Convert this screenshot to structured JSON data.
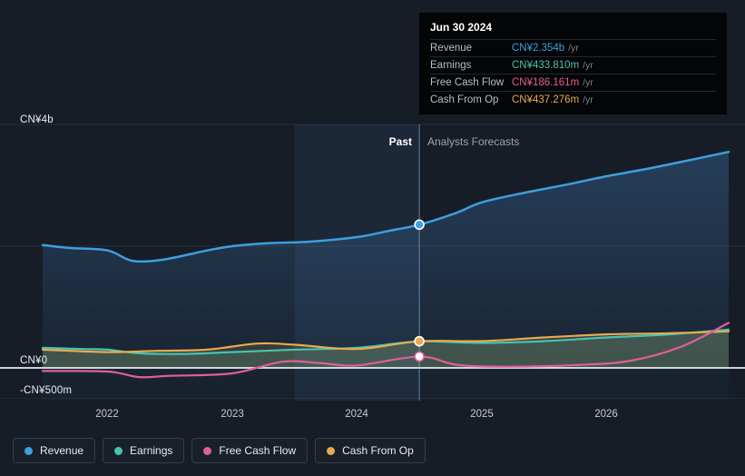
{
  "labels": {
    "past": "Past",
    "analysts_forecasts": "Analysts Forecasts"
  },
  "tooltip": {
    "date": "Jun 30 2024",
    "rows": [
      {
        "label": "Revenue",
        "value": "CN¥2.354b",
        "suffix": "/yr",
        "color": "#3d9fe0"
      },
      {
        "label": "Earnings",
        "value": "CN¥433.810m",
        "suffix": "/yr",
        "color": "#45c4b0"
      },
      {
        "label": "Free Cash Flow",
        "value": "CN¥186.161m",
        "suffix": "/yr",
        "color": "#e05f9a"
      },
      {
        "label": "Cash From Op",
        "value": "CN¥437.276m",
        "suffix": "/yr",
        "color": "#e8aa50"
      }
    ]
  },
  "legend": {
    "items": [
      {
        "label": "Revenue",
        "color": "#3d9fe0"
      },
      {
        "label": "Earnings",
        "color": "#45c4b0"
      },
      {
        "label": "Free Cash Flow",
        "color": "#e05f9a"
      },
      {
        "label": "Cash From Op",
        "color": "#e8aa50"
      }
    ]
  },
  "chart_data": {
    "type": "line",
    "title": "",
    "y_unit": "CN¥ billions",
    "x_axis": {
      "ticks": [
        2022,
        2023,
        2024,
        2025,
        2026
      ],
      "range": [
        2021.48,
        2026.98
      ]
    },
    "y_axis": {
      "tick_labels": [
        "CN¥4b",
        "CN¥0",
        "-CN¥500m"
      ],
      "tick_values_b": [
        4,
        0,
        -0.5
      ],
      "grid_values_b": [
        4,
        2
      ],
      "range_b": [
        -0.55,
        4.5
      ]
    },
    "divider_x": 2024.5,
    "past_band": [
      2023.5,
      2024.5
    ],
    "series": [
      {
        "name": "Revenue",
        "color": "#3d9fe0",
        "width": 2.5,
        "area": "to_bottom",
        "fill": "url(#gradRev)",
        "points": [
          [
            2021.48,
            2.02
          ],
          [
            2021.7,
            1.97
          ],
          [
            2022.0,
            1.93
          ],
          [
            2022.2,
            1.76
          ],
          [
            2022.45,
            1.78
          ],
          [
            2022.8,
            1.93
          ],
          [
            2023.0,
            2.0
          ],
          [
            2023.3,
            2.05
          ],
          [
            2023.6,
            2.07
          ],
          [
            2024.0,
            2.15
          ],
          [
            2024.25,
            2.25
          ],
          [
            2024.5,
            2.354
          ],
          [
            2024.8,
            2.55
          ],
          [
            2025.0,
            2.72
          ],
          [
            2025.35,
            2.88
          ],
          [
            2025.7,
            3.02
          ],
          [
            2026.0,
            3.15
          ],
          [
            2026.4,
            3.3
          ],
          [
            2026.98,
            3.55
          ]
        ]
      },
      {
        "name": "Earnings",
        "color": "#45c4b0",
        "width": 2.2,
        "area": "to_zero",
        "fill": "rgba(69,196,176,0.20)",
        "points": [
          [
            2021.48,
            0.33
          ],
          [
            2021.8,
            0.31
          ],
          [
            2022.0,
            0.3
          ],
          [
            2022.25,
            0.24
          ],
          [
            2022.6,
            0.23
          ],
          [
            2023.0,
            0.26
          ],
          [
            2023.5,
            0.3
          ],
          [
            2024.0,
            0.33
          ],
          [
            2024.5,
            0.434
          ],
          [
            2025.0,
            0.41
          ],
          [
            2025.5,
            0.44
          ],
          [
            2026.0,
            0.5
          ],
          [
            2026.5,
            0.55
          ],
          [
            2026.98,
            0.63
          ]
        ]
      },
      {
        "name": "Cash From Op",
        "color": "#e8aa50",
        "width": 2.2,
        "area": "to_zero",
        "fill": "rgba(232,170,80,0.16)",
        "points": [
          [
            2021.48,
            0.3
          ],
          [
            2022.0,
            0.26
          ],
          [
            2022.4,
            0.28
          ],
          [
            2022.8,
            0.3
          ],
          [
            2023.2,
            0.4
          ],
          [
            2023.5,
            0.38
          ],
          [
            2024.0,
            0.31
          ],
          [
            2024.5,
            0.437
          ],
          [
            2025.0,
            0.44
          ],
          [
            2025.5,
            0.5
          ],
          [
            2026.0,
            0.55
          ],
          [
            2026.5,
            0.57
          ],
          [
            2026.98,
            0.6
          ]
        ]
      },
      {
        "name": "Free Cash Flow",
        "color": "#e05f9a",
        "width": 2.2,
        "area": "none",
        "fill": "none",
        "points": [
          [
            2021.48,
            -0.05
          ],
          [
            2022.0,
            -0.06
          ],
          [
            2022.25,
            -0.15
          ],
          [
            2022.5,
            -0.13
          ],
          [
            2023.0,
            -0.09
          ],
          [
            2023.4,
            0.1
          ],
          [
            2023.7,
            0.08
          ],
          [
            2024.0,
            0.04
          ],
          [
            2024.5,
            0.186
          ],
          [
            2024.8,
            0.05
          ],
          [
            2025.2,
            0.02
          ],
          [
            2025.8,
            0.05
          ],
          [
            2026.2,
            0.12
          ],
          [
            2026.6,
            0.35
          ],
          [
            2026.98,
            0.74
          ]
        ]
      }
    ],
    "markers": [
      {
        "series": "Revenue",
        "x": 2024.5,
        "style": "filled"
      },
      {
        "series": "Cash From Op",
        "x": 2024.5,
        "style": "filled"
      },
      {
        "series": "Free Cash Flow",
        "x": 2024.5,
        "style": "open"
      }
    ]
  }
}
